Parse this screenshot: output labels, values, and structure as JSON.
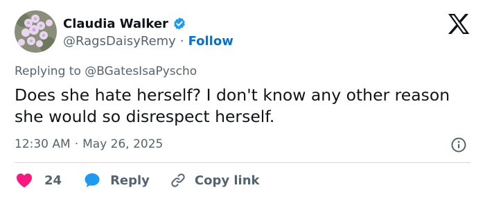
{
  "author": {
    "name": "Claudia Walker",
    "handle": "@RagsDaisyRemy",
    "separator": "·",
    "follow_label": "Follow",
    "verified_icon": "verified-badge-icon"
  },
  "brand": {
    "logo": "x-logo-icon"
  },
  "reply_context": "Replying to @BGatesIsaPyscho",
  "tweet": {
    "text": "Does she hate herself?  I don't know any other reason she would so disrespect herself.",
    "time": "12:30 AM",
    "separator": "·",
    "date": "May 26, 2025"
  },
  "actions": {
    "like_count": "24",
    "reply_label": "Reply",
    "copy_link_label": "Copy link"
  },
  "colors": {
    "like_heart": "#f91880",
    "reply_bubble": "#1d9bf0",
    "verified_badge": "#1d9bf0",
    "follow_link": "#0074d4",
    "secondary_text": "#536471"
  }
}
